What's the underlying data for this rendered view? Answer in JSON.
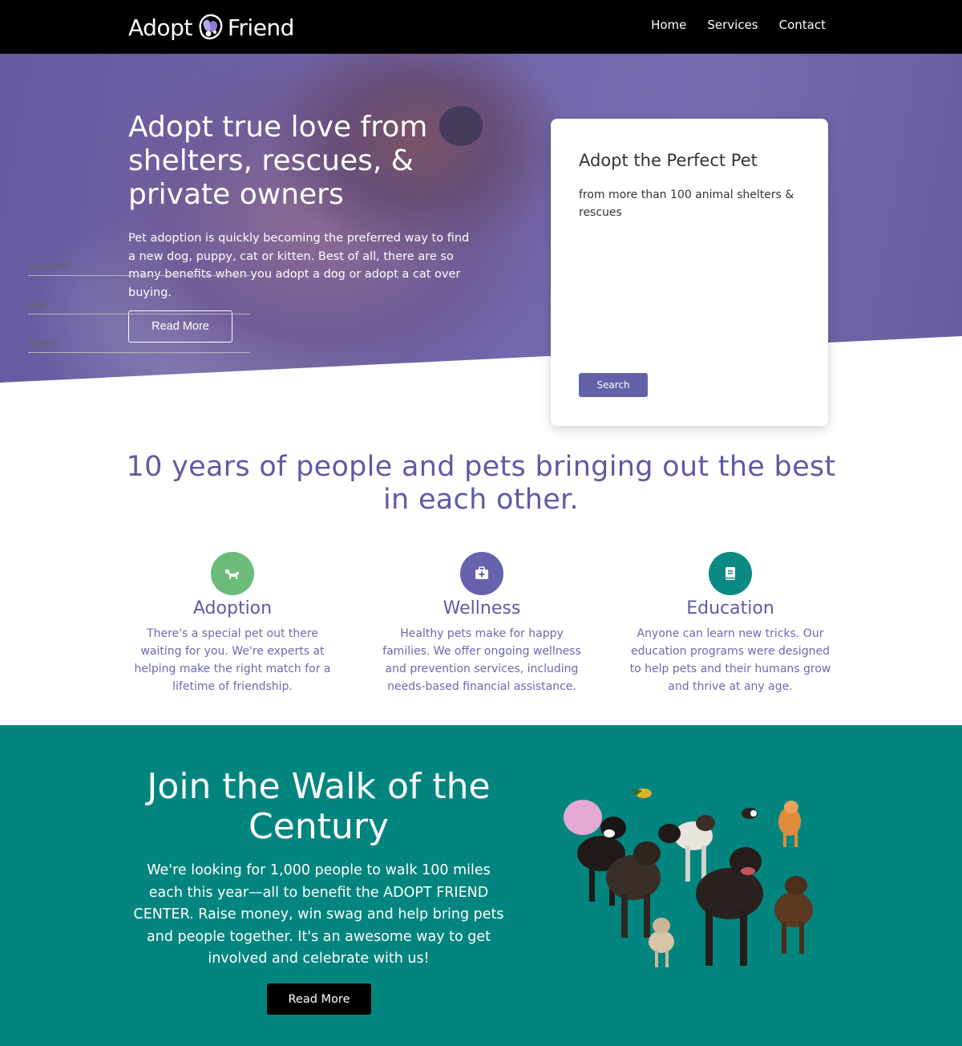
{
  "nav": {
    "logo_left": "Adopt",
    "logo_right": "Friend",
    "links": [
      "Home",
      "Services",
      "Contact"
    ]
  },
  "hero": {
    "title": "Adopt true love from shelters, rescues, & private owners",
    "description": "Pet adoption is quickly becoming the preferred way to find a new dog, puppy, cat or kitten. Best of all, there are so many benefits when you adopt a dog or adopt a cat over buying.",
    "button": "Read More"
  },
  "search_card": {
    "title": "Adopt the Perfect Pet",
    "subtitle": "from more than 100 animal shelters & rescues",
    "location_placeholder": "Location",
    "age_placeholder": "Age",
    "breed_placeholder": "Breed",
    "button": "Search"
  },
  "tagline": "10 years of people and pets bringing out the best in each other.",
  "features": [
    {
      "title": "Adoption",
      "icon": "dog-icon",
      "color": "#6dbb78",
      "description": "There's a special pet out there waiting for you. We're experts at helping make the right match for a lifetime of friendship."
    },
    {
      "title": "Wellness",
      "icon": "medical-kit-icon",
      "color": "#6762ad",
      "description": "Healthy pets make for happy families. We offer ongoing wellness and prevention services, including needs-based financial assistance."
    },
    {
      "title": "Education",
      "icon": "book-icon",
      "color": "#0a8a83",
      "description": "Anyone can learn new tricks. Our education programs were designed to help pets and their humans grow and thrive at any age."
    }
  ],
  "cta": {
    "title": "Join the Walk of the Century",
    "description": "We're looking for 1,000 people to walk 100 miles each this year—all to benefit the ADOPT FRIEND CENTER. Raise money, win swag and help bring pets and people together. It's an awesome way to get involved and celebrate with us!",
    "button": "Read More"
  },
  "colors": {
    "nav_bg": "#000000",
    "accent": "#5e5aa5",
    "teal": "#02857e",
    "search_button": "#6361a8"
  }
}
